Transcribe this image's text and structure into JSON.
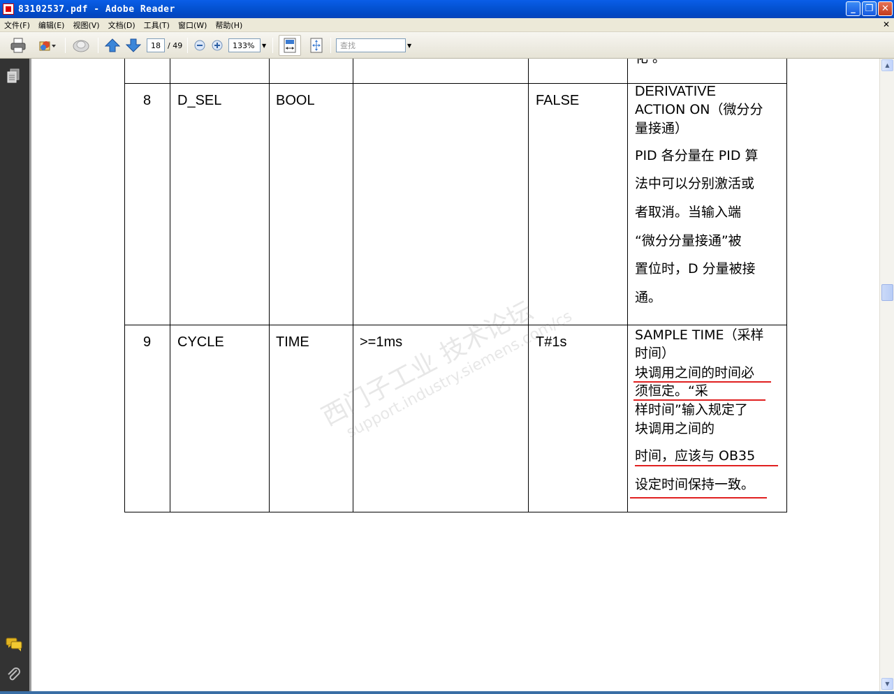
{
  "window": {
    "title": "83102537.pdf - Adobe Reader",
    "min_label": "_",
    "max_label": "❐",
    "close_label": "✕"
  },
  "menu": {
    "items": [
      "文件(F)",
      "编辑(E)",
      "视图(V)",
      "文档(D)",
      "工具(T)",
      "窗口(W)",
      "帮助(H)"
    ],
    "doc_close": "✕"
  },
  "toolbar": {
    "page_current": "18",
    "page_total": "/ 49",
    "zoom": "133%",
    "search_placeholder": "查找"
  },
  "table": {
    "top_fragment": "化     。",
    "rows": [
      {
        "no": "8",
        "name": "D_SEL",
        "type": "BOOL",
        "range": "",
        "default": "FALSE",
        "desc_en": [
          "DERIVATIVE",
          "ACTION ON（微分分",
          "量接通）"
        ],
        "desc_zh": [
          "PID 各分量在 PID 算",
          "法中可以分别激活或",
          "者取消。当输入端",
          "“微分分量接通”被",
          "置位时，D 分量被接",
          "通。"
        ]
      },
      {
        "no": "9",
        "name": "CYCLE",
        "type": "TIME",
        "range": ">=1ms",
        "default": "T#1s",
        "desc_lines": [
          "SAMPLE TIME（采样",
          "时间）",
          "块调用之间的时间必",
          "须恒定。“采",
          "样时间”输入规定了",
          "块调用之间的",
          "时间，应该与 OB35",
          "设定时间保持一致。"
        ]
      }
    ]
  },
  "watermark": {
    "line1": "西门子工业  技术论坛",
    "line2": "support.industry.siemens.com/cs"
  },
  "colors": {
    "titlebar": "#0453d4",
    "annotation_underline": "#e02020",
    "nav_panel": "#333333"
  },
  "icons": [
    "print-icon",
    "share-icon",
    "hand-icon",
    "prev-page-icon",
    "next-page-icon",
    "zoom-out-icon",
    "zoom-in-icon",
    "fit-width-icon",
    "fit-page-icon",
    "pages-icon",
    "comments-icon",
    "attachments-icon"
  ]
}
